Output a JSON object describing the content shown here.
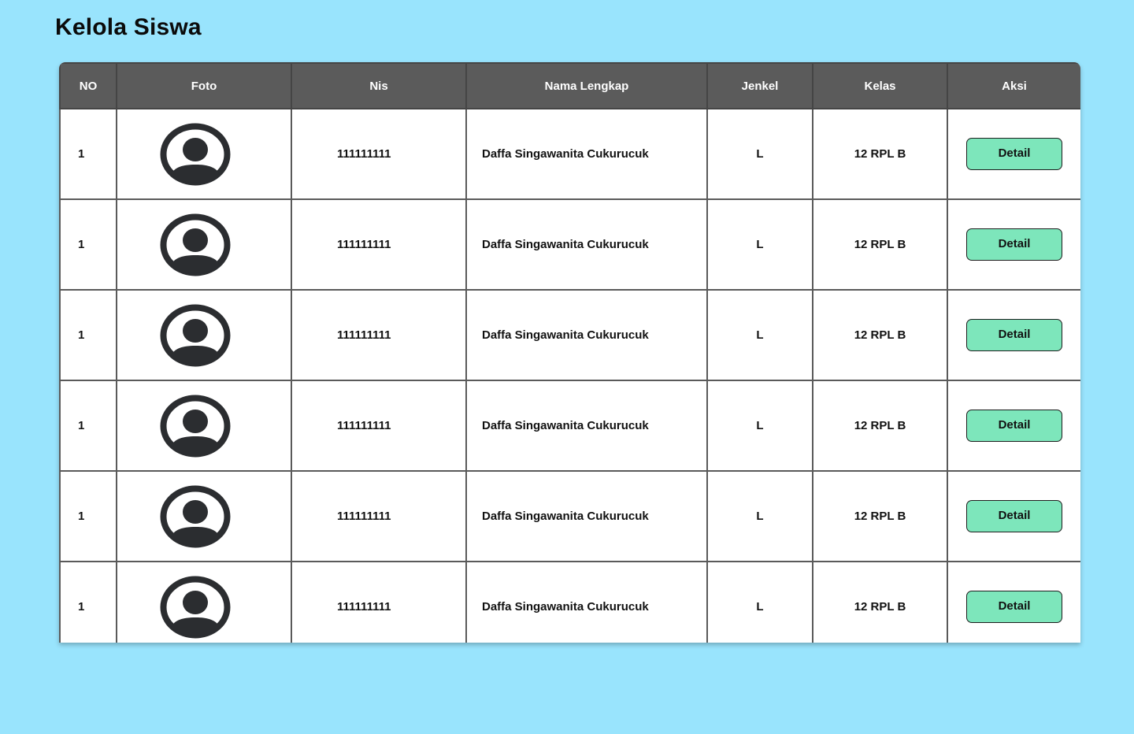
{
  "page": {
    "title": "Kelola Siswa"
  },
  "table": {
    "headers": [
      "NO",
      "Foto",
      "Nis",
      "Nama Lengkap",
      "Jenkel",
      "Kelas",
      "Aksi"
    ],
    "rows": [
      {
        "no": "1",
        "nis": "111111111",
        "nama": "Daffa Singawanita Cukurucuk",
        "jenkel": "L",
        "kelas": "12 RPL B",
        "aksi": "Detail"
      },
      {
        "no": "1",
        "nis": "111111111",
        "nama": "Daffa Singawanita Cukurucuk",
        "jenkel": "L",
        "kelas": "12 RPL B",
        "aksi": "Detail"
      },
      {
        "no": "1",
        "nis": "111111111",
        "nama": "Daffa Singawanita Cukurucuk",
        "jenkel": "L",
        "kelas": "12 RPL B",
        "aksi": "Detail"
      },
      {
        "no": "1",
        "nis": "111111111",
        "nama": "Daffa Singawanita Cukurucuk",
        "jenkel": "L",
        "kelas": "12 RPL B",
        "aksi": "Detail"
      },
      {
        "no": "1",
        "nis": "111111111",
        "nama": "Daffa Singawanita Cukurucuk",
        "jenkel": "L",
        "kelas": "12 RPL B",
        "aksi": "Detail"
      },
      {
        "no": "1",
        "nis": "111111111",
        "nama": "Daffa Singawanita Cukurucuk",
        "jenkel": "L",
        "kelas": "12 RPL B",
        "aksi": "Detail"
      }
    ]
  },
  "icons": {
    "foto": "user-avatar-icon"
  },
  "colors": {
    "background": "#99e4fd",
    "header": "#5b5b5b",
    "detail_button": "#7de6bb",
    "avatar": "#2b2d30"
  }
}
